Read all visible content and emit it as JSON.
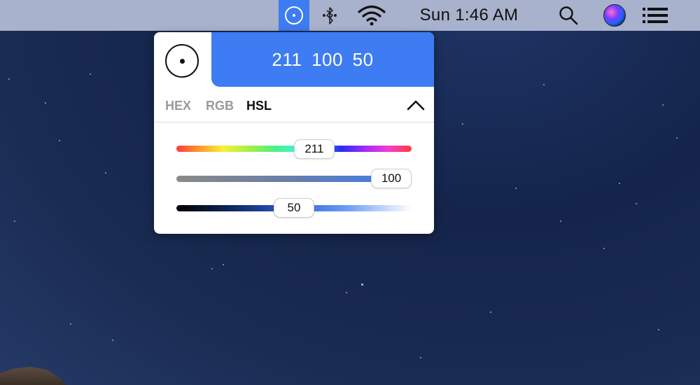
{
  "menubar": {
    "clock": "Sun 1:46 AM",
    "icons": {
      "color_picker": "color-picker-icon",
      "bluetooth": "bluetooth-icon",
      "wifi": "wifi-icon",
      "search": "search-icon",
      "siri": "siri-icon",
      "notification_center": "list-icon"
    },
    "accent_color": "#3d7cf2"
  },
  "panel": {
    "color_value": "211 100 50",
    "preview_color": "#3d7cf2",
    "tabs": [
      {
        "label": "HEX",
        "active": false
      },
      {
        "label": "RGB",
        "active": false
      },
      {
        "label": "HSL",
        "active": true
      }
    ],
    "sliders": {
      "hue": {
        "value": "211",
        "fraction": 0.586
      },
      "saturation": {
        "value": "100",
        "fraction": 1.0
      },
      "lightness": {
        "value": "50",
        "fraction": 0.5
      }
    }
  }
}
